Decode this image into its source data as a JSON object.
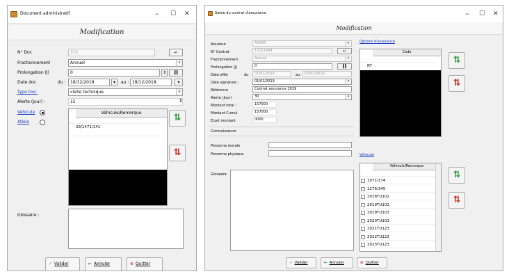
{
  "left": {
    "title": "Document administratif",
    "banner": "Modification",
    "labels": {
      "num": "N° Doc",
      "fract": "Fractionnement",
      "prolong": "Prolongation (J)",
      "datedoc": "Date doc",
      "du": "du :",
      "au": "au :",
      "type": "Type Doc.",
      "alerte": "Alerte (Jour) :",
      "vehicule": "Véhicule",
      "agence": "Atlelo",
      "glossaire": "Glossaire :"
    },
    "values": {
      "num": "372",
      "fract": "Annuel",
      "prolong": "0",
      "du": "18/12/2018",
      "au": "18/12/2018",
      "type": "visite technique",
      "alerte": "15"
    },
    "grid_header": "Véhicule/Remorque",
    "grid_row": "28/1471/141",
    "buttons": {
      "valider": "Valider",
      "annuler": "Annuler",
      "quitter": "Quitter"
    }
  },
  "right": {
    "title": "Saisie du contrat d'assurance",
    "banner": "Modification",
    "labels": {
      "assureur": "Assureur",
      "contrat": "N° Contrat",
      "fract": "Fractionnement",
      "prolong": "Prolongation (J)",
      "date": "Date effet",
      "du": "du",
      "au": "au",
      "signature": "Date signature :",
      "reference": "Référence",
      "alerte": "Alerte (Jour)",
      "total": "Montant total :",
      "cumul": "Montant Cumul",
      "ecart": "Ecart montant",
      "connaisseurs": "Connaisseurs",
      "morale": "Personne morale",
      "physique": "Personne physique",
      "glossaire": "Glossaire",
      "options": "Options d'assurance",
      "vehicule": "Véhicule"
    },
    "values": {
      "assureur": "AXIMA",
      "contrat": "12121999",
      "fract": "Annuel",
      "prolong": "0",
      "du": "01/01/2019",
      "au": "07/01/2019",
      "signature": "01/01/2019",
      "reference": "Contrat assurance 2019",
      "alerte": "30",
      "total": "157000",
      "cumul": "157000",
      "ecart": "0000"
    },
    "options_header": "Code",
    "options_row": "RT",
    "veh_header": "Véhicule/Remorque",
    "veh_rows": [
      "1071/174",
      "1276/345",
      "2018TU102",
      "2019TU102",
      "2019TU103",
      "2020TU103",
      "2021TU123",
      "2022TU123",
      "2023TU123"
    ],
    "buttons": {
      "valider": "Valider",
      "annuler": "Annuler",
      "quitter": "Quitter"
    }
  },
  "colors": {
    "link": "#1a3cc8",
    "add": "#2e9a3c",
    "remove": "#c8301e",
    "ok": "#2e7dd1"
  }
}
